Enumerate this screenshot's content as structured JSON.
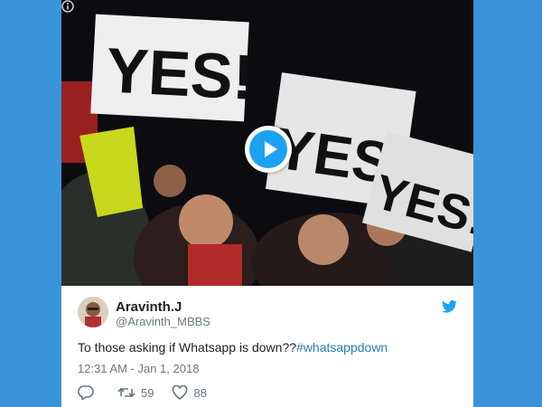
{
  "media": {
    "info_icon": "info-icon",
    "play_icon": "play-icon",
    "sign_text": "YES!"
  },
  "tweet": {
    "display_name": "Aravinth.J",
    "handle": "@Aravinth_MBBS",
    "text": "To those asking if Whatsapp is down??",
    "hashtag": "#whatsappdown",
    "timestamp": "12:31 AM - Jan 1, 2018",
    "retweets": "59",
    "likes": "88"
  },
  "colors": {
    "background": "#3b94d9",
    "accent": "#1da1f2",
    "link": "#2b7bb9",
    "muted": "#697882"
  }
}
